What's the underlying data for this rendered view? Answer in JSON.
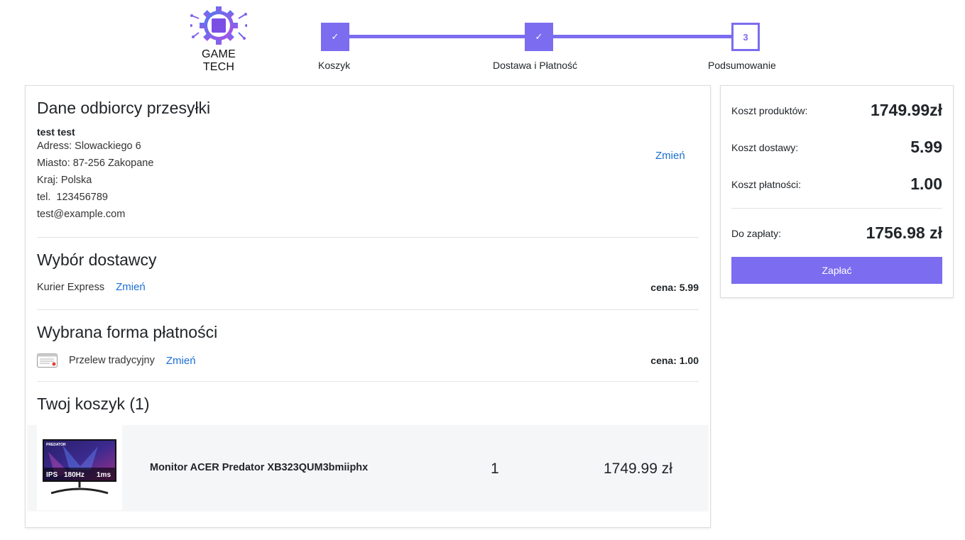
{
  "brand": {
    "name": "GAME TECH",
    "accent": "#7b6cf0"
  },
  "stepper": {
    "steps": [
      {
        "label": "Koszyk",
        "state": "done",
        "marker": "✓"
      },
      {
        "label": "Dostawa i Płatność",
        "state": "done",
        "marker": "✓"
      },
      {
        "label": "Podsumowanie",
        "state": "current",
        "marker": "3"
      }
    ]
  },
  "recipient": {
    "title": "Dane odbiorcy przesyłki",
    "name": "test test",
    "address": "Adress: Slowackiego 6",
    "city": "Miasto: 87-256 Zakopane",
    "country": "Kraj: Polska",
    "phone": "tel.  123456789",
    "email": "test@example.com",
    "change_label": "Zmień"
  },
  "delivery": {
    "title": "Wybór dostawcy",
    "method": "Kurier Express",
    "change_label": "Zmień",
    "price": "cena: 5.99"
  },
  "payment": {
    "title": "Wybrana forma płatności",
    "icon": "bank-transfer-icon",
    "method": "Przelew tradycyjny",
    "change_label": "Zmień",
    "price": "cena: 1.00"
  },
  "cart": {
    "title": "Twoj koszyk (1)",
    "items": [
      {
        "name": "Monitor ACER Predator XB323QUM3bmiiphx",
        "quantity": "1",
        "price": "1749.99 zł",
        "image_text": {
          "brand": "PREDATOR",
          "panel": "IPS",
          "refresh": "180Hz",
          "response": "1ms"
        }
      }
    ]
  },
  "summary": {
    "products_label": "Koszt produktów:",
    "products_value": "1749.99zł",
    "shipping_label": "Koszt dostawy:",
    "shipping_value": "5.99",
    "payment_label": "Koszt płatności:",
    "payment_value": "1.00",
    "total_label": "Do zapłaty:",
    "total_value": "1756.98 zł",
    "pay_button": "Zapłać"
  }
}
